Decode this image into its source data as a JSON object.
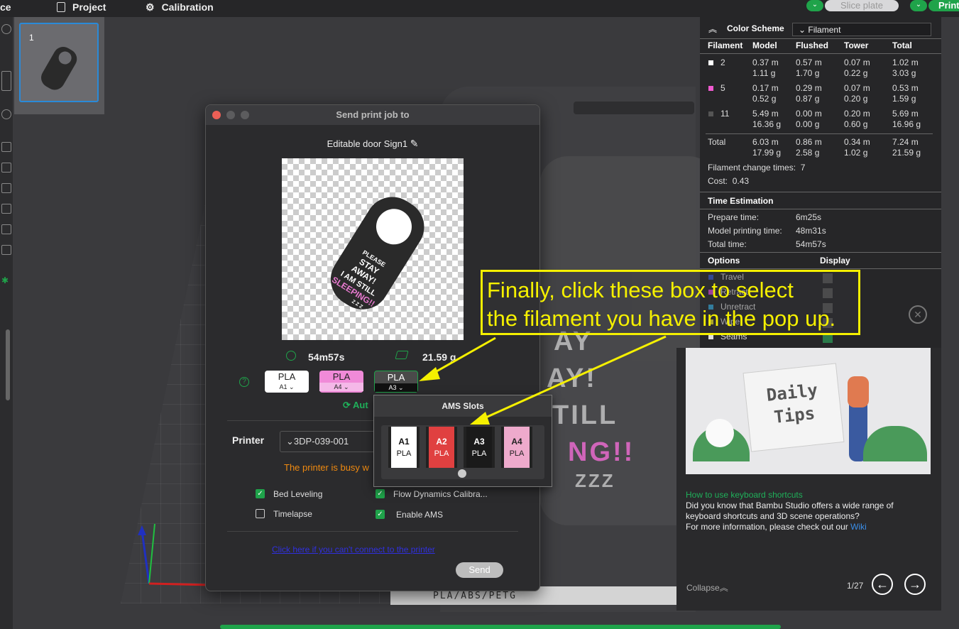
{
  "topbar": {
    "left_fragment": "ce",
    "project_label": "Project",
    "calibration_label": "Calibration",
    "slice_plate_label": "Slice plate",
    "print_label": "Print"
  },
  "plate": {
    "thumbnail_number": "1",
    "label": "PLA/ABS/PETG",
    "model_text": [
      "AY",
      "AY!",
      "TILL",
      "NG!!",
      "ZZZ"
    ]
  },
  "dialog": {
    "title": "Send print job to",
    "job_name": "Editable door Sign1",
    "time": "54m57s",
    "weight": "21.59 g",
    "filaments": [
      {
        "type": "PLA",
        "slot": "A1",
        "color": "#ffffff",
        "text": "#222222"
      },
      {
        "type": "PLA",
        "slot": "A4",
        "color": "#f08ad8",
        "text": "#222222"
      },
      {
        "type": "PLA",
        "slot": "A3",
        "color": "#4a4a4a",
        "text": "#ffffff"
      }
    ],
    "auto_fragment": "Aut",
    "printer_label": "Printer",
    "printer_name": "3DP-039-001",
    "busy_text": "The printer is busy w",
    "options": [
      {
        "label": "Bed Leveling",
        "checked": true
      },
      {
        "label": "Flow Dynamics Calibra...",
        "checked": true
      },
      {
        "label": "Timelapse",
        "checked": false
      },
      {
        "label": "Enable AMS",
        "checked": true
      }
    ],
    "connect_link": "Click here if you can't connect to the printer",
    "send_label": "Send"
  },
  "ams": {
    "title": "AMS Slots",
    "slots": [
      {
        "id": "A1",
        "type": "PLA",
        "color": "#ffffff",
        "text": "#111111"
      },
      {
        "id": "A2",
        "type": "PLA",
        "color": "#e04040",
        "text": "#ffffff"
      },
      {
        "id": "A3",
        "type": "PLA",
        "color": "#1a1a1a",
        "text": "#ffffff"
      },
      {
        "id": "A4",
        "type": "PLA",
        "color": "#eeaacc",
        "text": "#222222"
      }
    ]
  },
  "stats": {
    "color_scheme_label": "Color Scheme",
    "color_scheme_value": "Filament",
    "headers": [
      "Filament",
      "Model",
      "Flushed",
      "Tower",
      "Total"
    ],
    "rows": [
      {
        "id": "2",
        "swatch": "#ffffff",
        "model": [
          "0.37 m",
          "1.11 g"
        ],
        "flushed": [
          "0.57 m",
          "1.70 g"
        ],
        "tower": [
          "0.07 m",
          "0.22 g"
        ],
        "total": [
          "1.02 m",
          "3.03 g"
        ]
      },
      {
        "id": "5",
        "swatch": "#f05ad0",
        "model": [
          "0.17 m",
          "0.52 g"
        ],
        "flushed": [
          "0.29 m",
          "0.87 g"
        ],
        "tower": [
          "0.07 m",
          "0.20 g"
        ],
        "total": [
          "0.53 m",
          "1.59 g"
        ]
      },
      {
        "id": "11",
        "swatch": "#555555",
        "model": [
          "5.49 m",
          "16.36 g"
        ],
        "flushed": [
          "0.00 m",
          "0.00 g"
        ],
        "tower": [
          "0.20 m",
          "0.60 g"
        ],
        "total": [
          "5.69 m",
          "16.96 g"
        ]
      }
    ],
    "total_label": "Total",
    "total": {
      "model": [
        "6.03 m",
        "17.99 g"
      ],
      "flushed": [
        "0.86 m",
        "2.58 g"
      ],
      "tower": [
        "0.34 m",
        "1.02 g"
      ],
      "total": [
        "7.24 m",
        "21.59 g"
      ]
    },
    "change_times_label": "Filament change times:",
    "change_times": "7",
    "cost_label": "Cost:",
    "cost": "0.43",
    "time_estimation_label": "Time Estimation",
    "prepare_label": "Prepare time:",
    "prepare": "6m25s",
    "model_print_label": "Model printing time:",
    "model_print": "48m31s",
    "total_time_label": "Total time:",
    "total_time": "54m57s",
    "options_label": "Options",
    "display_label": "Display",
    "option_items": [
      {
        "label": "Travel",
        "color": "#3050c0"
      },
      {
        "label": "Retract",
        "color": "#d040d0"
      },
      {
        "label": "Unretract",
        "color": "#30a0d0"
      },
      {
        "label": "Wipe",
        "color": "#e8e020"
      },
      {
        "label": "Seams",
        "color": "#dddddd"
      }
    ]
  },
  "tips": {
    "image_text": [
      "Daily",
      "Tips"
    ],
    "link": "How to use keyboard shortcuts",
    "body1": "Did you know that Bambu Studio offers a wide range of",
    "body2": "keyboard shortcuts and 3D scene operations?",
    "body3": "For more information, please check out our",
    "wiki": "Wiki",
    "collapse": "Collapse",
    "page": "1/27"
  },
  "callout": {
    "line1": "Finally, click these box to select",
    "line2": "the filament you have in the pop up."
  }
}
